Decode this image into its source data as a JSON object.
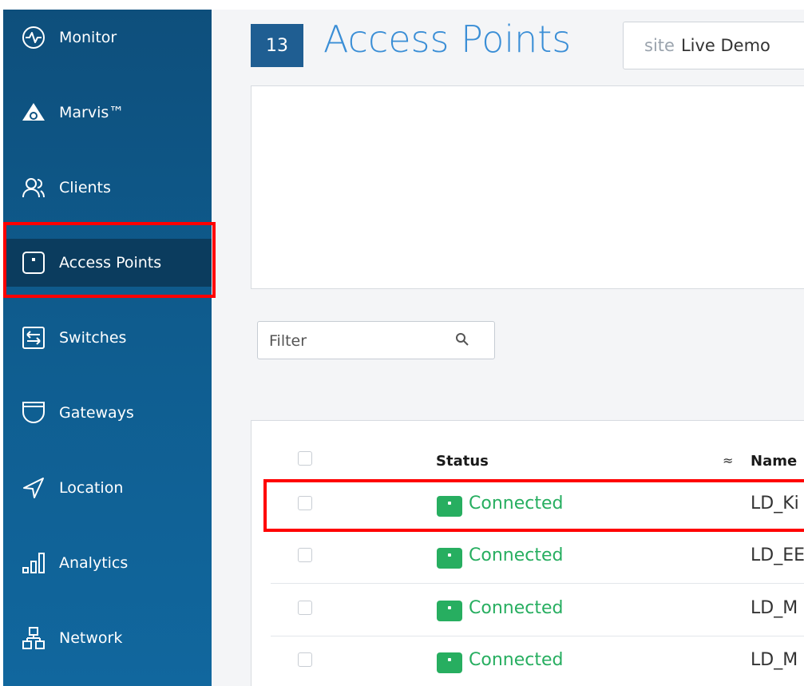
{
  "sidebar": {
    "items": [
      {
        "label": "Monitor",
        "icon": "monitor-icon"
      },
      {
        "label": "Marvis™",
        "icon": "marvis-icon"
      },
      {
        "label": "Clients",
        "icon": "clients-icon"
      },
      {
        "label": "Access Points",
        "icon": "access-point-icon",
        "active": true
      },
      {
        "label": "Switches",
        "icon": "switches-icon"
      },
      {
        "label": "Gateways",
        "icon": "gateways-icon"
      },
      {
        "label": "Location",
        "icon": "location-icon"
      },
      {
        "label": "Analytics",
        "icon": "analytics-icon"
      },
      {
        "label": "Network",
        "icon": "network-icon"
      }
    ]
  },
  "header": {
    "count": "13",
    "title": "Access Points",
    "site_prefix": "site",
    "site_value": "Live Demo"
  },
  "filter": {
    "placeholder": "Filter"
  },
  "table": {
    "columns": {
      "status": "Status",
      "name": "Name"
    },
    "rows": [
      {
        "status": "Connected",
        "name": "LD_Ki",
        "highlighted": true
      },
      {
        "status": "Connected",
        "name": "LD_EE"
      },
      {
        "status": "Connected",
        "name": "LD_M"
      },
      {
        "status": "Connected",
        "name": "LD_M"
      }
    ]
  },
  "colors": {
    "sidebar": "#0f5e91",
    "sidebar_active": "#0b3c5e",
    "accent": "#3a8ed6",
    "connected": "#27ae60",
    "highlight": "#ff0000"
  }
}
